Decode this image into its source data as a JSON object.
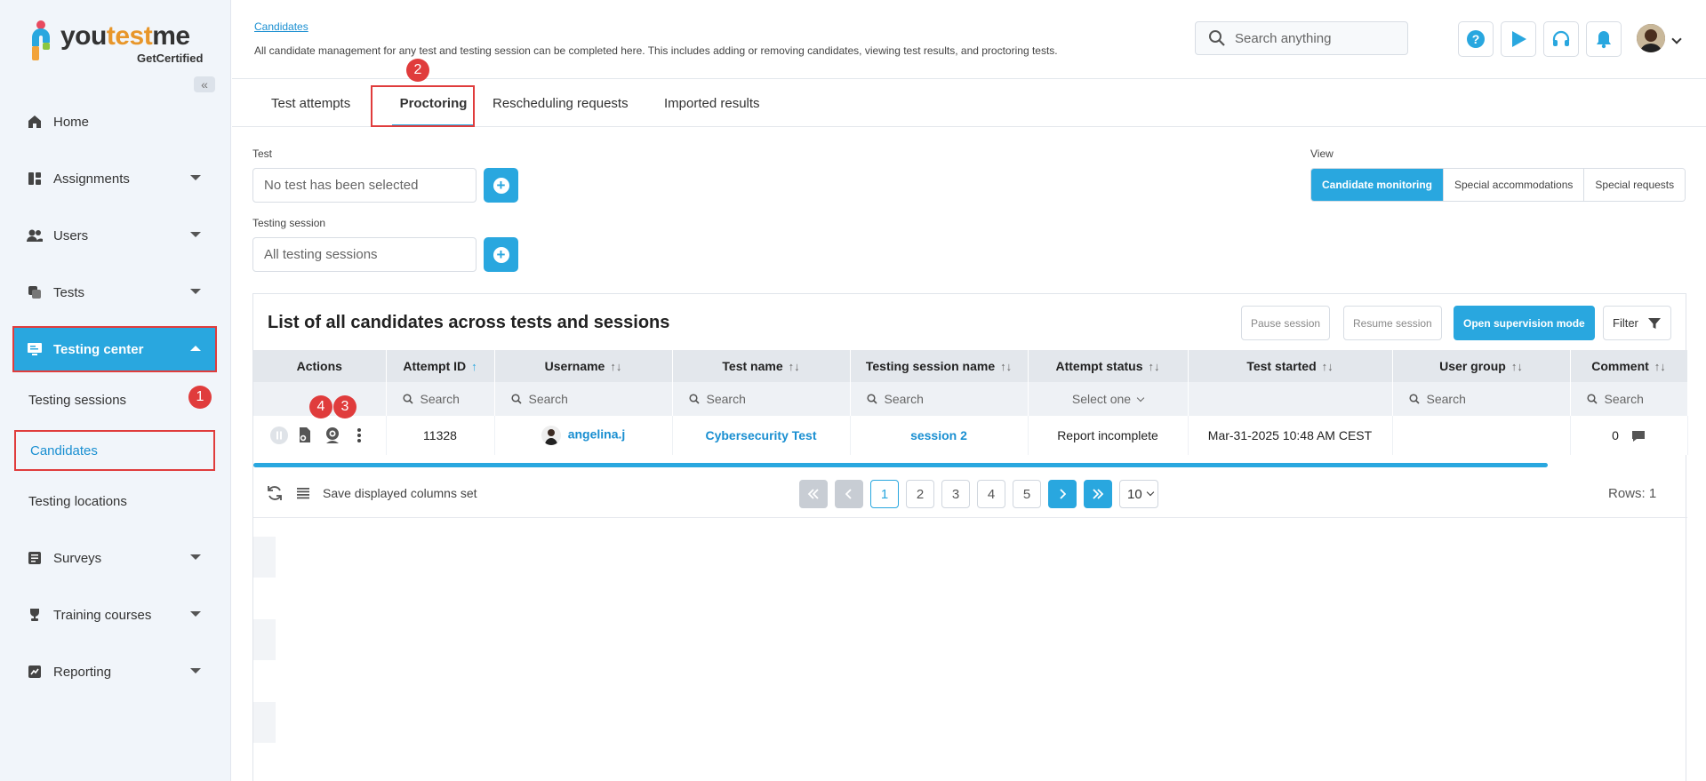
{
  "brand": {
    "name_part1": "you",
    "name_part2": "test",
    "name_part3": "me",
    "tagline": "GetCertified"
  },
  "sidebar": {
    "collapse_symbol": "«",
    "items": [
      {
        "label": "Home",
        "icon": "home-icon"
      },
      {
        "label": "Assignments",
        "icon": "assignments-icon"
      },
      {
        "label": "Users",
        "icon": "users-icon"
      },
      {
        "label": "Tests",
        "icon": "tests-icon"
      },
      {
        "label": "Testing center",
        "icon": "monitor-icon",
        "active": true
      },
      {
        "label": "Surveys",
        "icon": "surveys-icon"
      },
      {
        "label": "Training courses",
        "icon": "trophy-icon"
      },
      {
        "label": "Reporting",
        "icon": "reporting-icon"
      }
    ],
    "sub_items": [
      {
        "label": "Testing sessions"
      },
      {
        "label": "Candidates",
        "current": true
      },
      {
        "label": "Testing locations"
      }
    ]
  },
  "annotations": {
    "b1": "1",
    "b2": "2",
    "b3": "3",
    "b4": "4"
  },
  "header": {
    "breadcrumb": "Candidates",
    "description": "All candidate management for any test and testing session can be completed here. This includes adding or removing candidates, viewing test results, and proctoring tests.",
    "search_placeholder": "Search anything",
    "icons": [
      "help-icon",
      "play-icon",
      "headset-icon",
      "bell-icon"
    ]
  },
  "tabs": [
    {
      "label": "Test attempts"
    },
    {
      "label": "Proctoring",
      "active": true
    },
    {
      "label": "Rescheduling requests"
    },
    {
      "label": "Imported results"
    }
  ],
  "form": {
    "test_label": "Test",
    "test_value": "No test has been selected",
    "session_label": "Testing session",
    "session_value": "All testing sessions",
    "plus": "+"
  },
  "view": {
    "label": "View",
    "options": [
      "Candidate monitoring",
      "Special accommodations",
      "Special requests"
    ],
    "selected": "Candidate monitoring"
  },
  "panel": {
    "title": "List of all candidates across tests and sessions",
    "buttons": {
      "pause": "Pause session",
      "resume": "Resume session",
      "supervision": "Open supervision mode",
      "filter": "Filter"
    }
  },
  "table": {
    "sort_symbol": "↑↓",
    "columns": [
      "Actions",
      "Attempt ID",
      "Username",
      "Test name",
      "Testing session name",
      "Attempt status",
      "Test started",
      "User group",
      "Comment"
    ],
    "filter_placeholder": "Search",
    "status_filter": "Select one",
    "rows": [
      {
        "attempt_id": "11328",
        "username": "angelina.j",
        "test_name": "Cybersecurity Test",
        "session": "session 2",
        "status": "Report incomplete",
        "started": "Mar-31-2025 10:48 AM CEST",
        "group": "",
        "comment": "0"
      }
    ]
  },
  "footer": {
    "save_columns": "Save displayed columns set",
    "pages": [
      "1",
      "2",
      "3",
      "4",
      "5"
    ],
    "current_page": 1,
    "page_size": "10",
    "rows": "Rows: 1"
  },
  "colors": {
    "accent": "#29a7df",
    "highlight": "#e03c3c",
    "sidebar_bg": "#f1f5fa"
  }
}
